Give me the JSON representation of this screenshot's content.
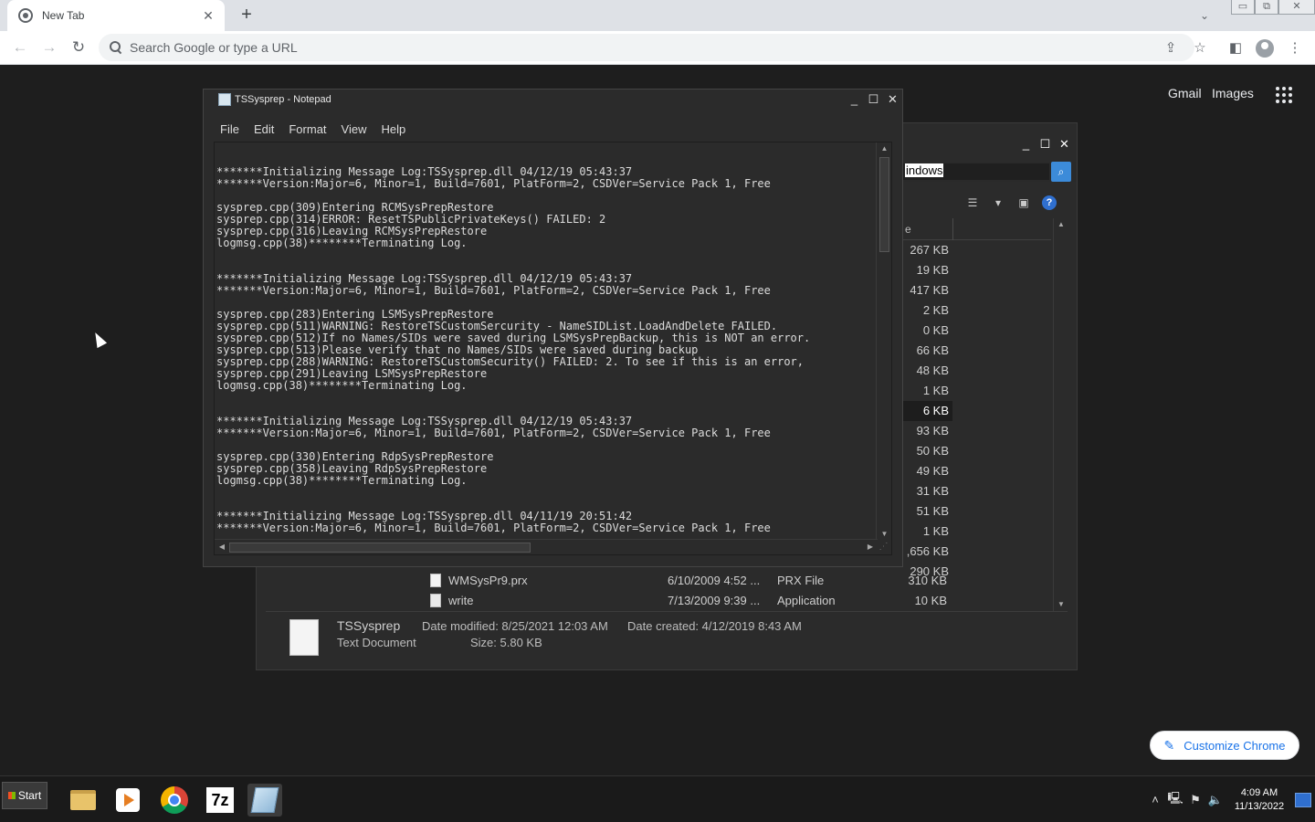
{
  "browser": {
    "tab_title": "New Tab",
    "tab_close": "✕",
    "new_tab": "+",
    "omnibox_placeholder": "Search Google or type a URL",
    "ntp_links": [
      "Gmail",
      "Images"
    ],
    "customize_label": "Customize Chrome",
    "window_controls": [
      "▭",
      "⧉",
      "✕"
    ],
    "icons": [
      "back-icon",
      "forward-icon",
      "reload-icon",
      "share-icon",
      "bookmark-star-icon",
      "side-panel-icon",
      "profile-icon",
      "menu-icon",
      "apps-grid-icon",
      "pencil-icon",
      "tab-search-icon"
    ]
  },
  "notepad": {
    "title": "TSSysprep - Notepad",
    "menu": [
      "File",
      "Edit",
      "Format",
      "View",
      "Help"
    ],
    "content": "*******Initializing Message Log:TSSysprep.dll 04/12/19 05:43:37\n*******Version:Major=6, Minor=1, Build=7601, PlatForm=2, CSDVer=Service Pack 1, Free\n\nsysprep.cpp(309)Entering RCMSysPrepRestore\nsysprep.cpp(314)ERROR: ResetTSPublicPrivateKeys() FAILED: 2\nsysprep.cpp(316)Leaving RCMSysPrepRestore\nlogmsg.cpp(38)********Terminating Log.\n\n\n*******Initializing Message Log:TSSysprep.dll 04/12/19 05:43:37\n*******Version:Major=6, Minor=1, Build=7601, PlatForm=2, CSDVer=Service Pack 1, Free\n\nsysprep.cpp(283)Entering LSMSysPrepRestore\nsysprep.cpp(511)WARNING: RestoreTSCustomSercurity - NameSIDList.LoadAndDelete FAILED.\nsysprep.cpp(512)If no Names/SIDs were saved during LSMSysPrepBackup, this is NOT an error.\nsysprep.cpp(513)Please verify that no Names/SIDs were saved during backup\nsysprep.cpp(288)WARNING: RestoreTSCustomSecurity() FAILED: 2. To see if this is an error,\nsysprep.cpp(291)Leaving LSMSysPrepRestore\nlogmsg.cpp(38)********Terminating Log.\n\n\n*******Initializing Message Log:TSSysprep.dll 04/12/19 05:43:37\n*******Version:Major=6, Minor=1, Build=7601, PlatForm=2, CSDVer=Service Pack 1, Free\n\nsysprep.cpp(330)Entering RdpSysPrepRestore\nsysprep.cpp(358)Leaving RdpSysPrepRestore\nlogmsg.cpp(38)********Terminating Log.\n\n\n*******Initializing Message Log:TSSysprep.dll 04/11/19 20:51:42\n*******Version:Major=6, Minor=1, Build=7601, PlatForm=2, CSDVer=Service Pack 1, Free"
  },
  "explorer": {
    "search_value": "indows",
    "column_header_fragment": "e",
    "sizes": [
      "267 KB",
      "19 KB",
      "417 KB",
      "2 KB",
      "0 KB",
      "66 KB",
      "48 KB",
      "1 KB",
      "6 KB",
      "93 KB",
      "50 KB",
      "49 KB",
      "31 KB",
      "51 KB",
      "1 KB",
      ",656 KB",
      "290 KB"
    ],
    "selected_size_index": 8,
    "rows": [
      {
        "name": "WMSysPr9.prx",
        "date": "6/10/2009 4:52 ...",
        "type": "PRX File",
        "size": "310 KB"
      },
      {
        "name": "write",
        "date": "7/13/2009 9:39 ...",
        "type": "Application",
        "size": "10 KB"
      }
    ],
    "details": {
      "name": "TSSysprep",
      "type": "Text Document",
      "modified": "Date modified: 8/25/2021 12:03 AM",
      "created": "Date created: 4/12/2019 8:43 AM",
      "size": "Size: 5.80 KB"
    }
  },
  "taskbar": {
    "start_label": "Start",
    "time": "4:09 AM",
    "date": "11/13/2022",
    "apps": [
      "file-explorer",
      "media-player",
      "chrome",
      "7-zip",
      "notepad"
    ]
  }
}
